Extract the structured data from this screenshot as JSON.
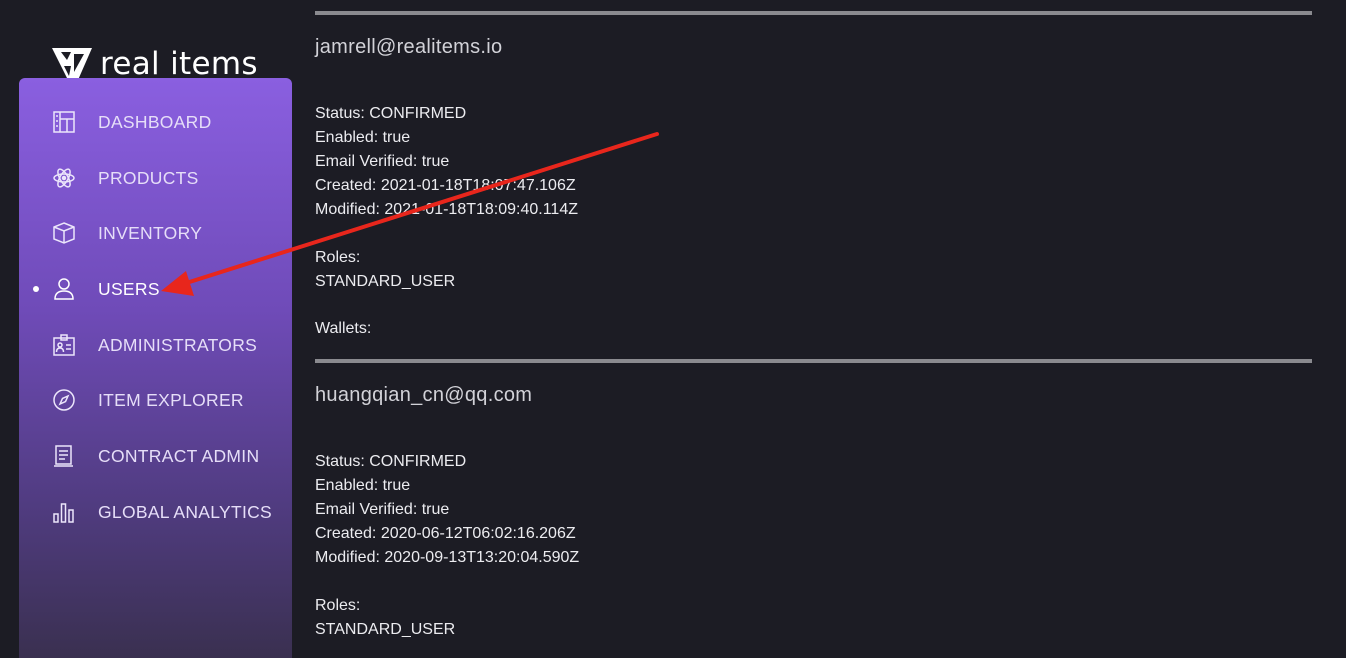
{
  "brand": {
    "name": "real items"
  },
  "sidebar": {
    "items": [
      {
        "label": "DASHBOARD",
        "icon": "dashboard-icon",
        "active": false
      },
      {
        "label": "PRODUCTS",
        "icon": "atom-icon",
        "active": false
      },
      {
        "label": "INVENTORY",
        "icon": "box-icon",
        "active": false
      },
      {
        "label": "USERS",
        "icon": "user-icon",
        "active": true
      },
      {
        "label": "ADMINISTRATORS",
        "icon": "id-card-icon",
        "active": false
      },
      {
        "label": "ITEM EXPLORER",
        "icon": "compass-icon",
        "active": false
      },
      {
        "label": "CONTRACT ADMIN",
        "icon": "document-icon",
        "active": false
      },
      {
        "label": "GLOBAL ANALYTICS",
        "icon": "bar-chart-icon",
        "active": false
      }
    ]
  },
  "users": [
    {
      "email": "jamrell@realitems.io",
      "status": "Status: CONFIRMED",
      "enabled": "Enabled: true",
      "email_verified": "Email Verified: true",
      "created": "Created: 2021-01-18T18:07:47.106Z",
      "modified": "Modified: 2021-01-18T18:09:40.114Z",
      "roles_label": "Roles:",
      "role": "STANDARD_USER",
      "wallets_label": "Wallets:"
    },
    {
      "email": "huangqian_cn@qq.com",
      "status": "Status: CONFIRMED",
      "enabled": "Enabled: true",
      "email_verified": "Email Verified: true",
      "created": "Created: 2020-06-12T06:02:16.206Z",
      "modified": "Modified: 2020-09-13T13:20:04.590Z",
      "roles_label": "Roles:",
      "role": "STANDARD_USER"
    }
  ],
  "colors": {
    "background": "#1c1c24",
    "sidebar_top": "#8a5fe0",
    "sidebar_bottom": "#3a3050",
    "annotation_arrow": "#e8261c"
  }
}
